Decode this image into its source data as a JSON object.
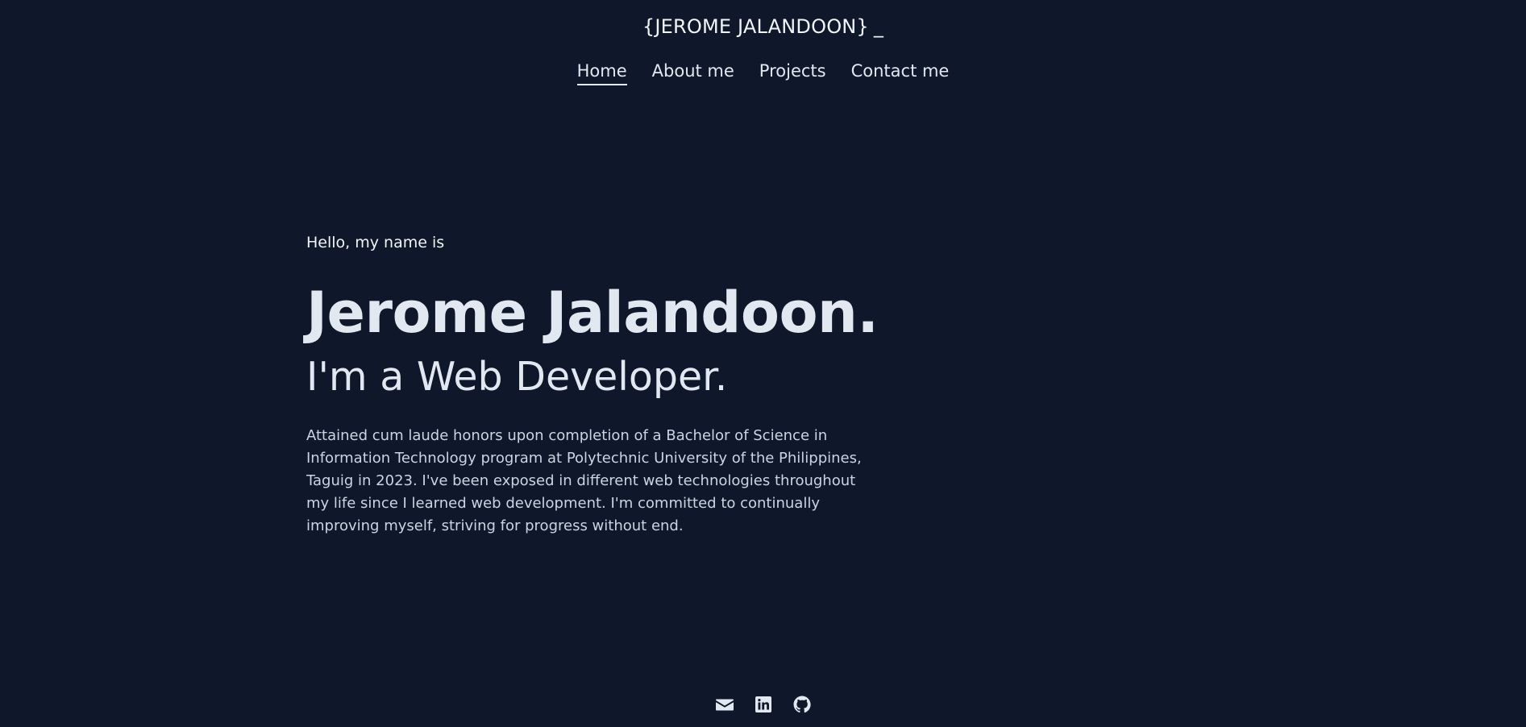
{
  "header": {
    "logo": "{JEROME JALANDOON}",
    "cursor": "_",
    "nav": [
      {
        "label": "Home",
        "active": true
      },
      {
        "label": "About me",
        "active": false
      },
      {
        "label": "Projects",
        "active": false
      },
      {
        "label": "Contact me",
        "active": false
      }
    ]
  },
  "hero": {
    "greeting": "Hello, my name is",
    "name": "Jerome Jalandoon.",
    "role": "I'm a Web Developer.",
    "bio": "Attained cum laude honors upon completion of a Bachelor of Science in Information Technology program at Polytechnic University of the Philippines, Taguig in 2023. I've been exposed in different web technologies throughout my life since I learned web development. I'm committed to continually improving myself, striving for progress without end."
  },
  "socials": [
    {
      "icon": "mail-icon"
    },
    {
      "icon": "linkedin-icon"
    },
    {
      "icon": "github-icon"
    }
  ],
  "colors": {
    "background": "#0f172a",
    "text": "#e2e8f0",
    "muted": "#cbd5e1"
  }
}
